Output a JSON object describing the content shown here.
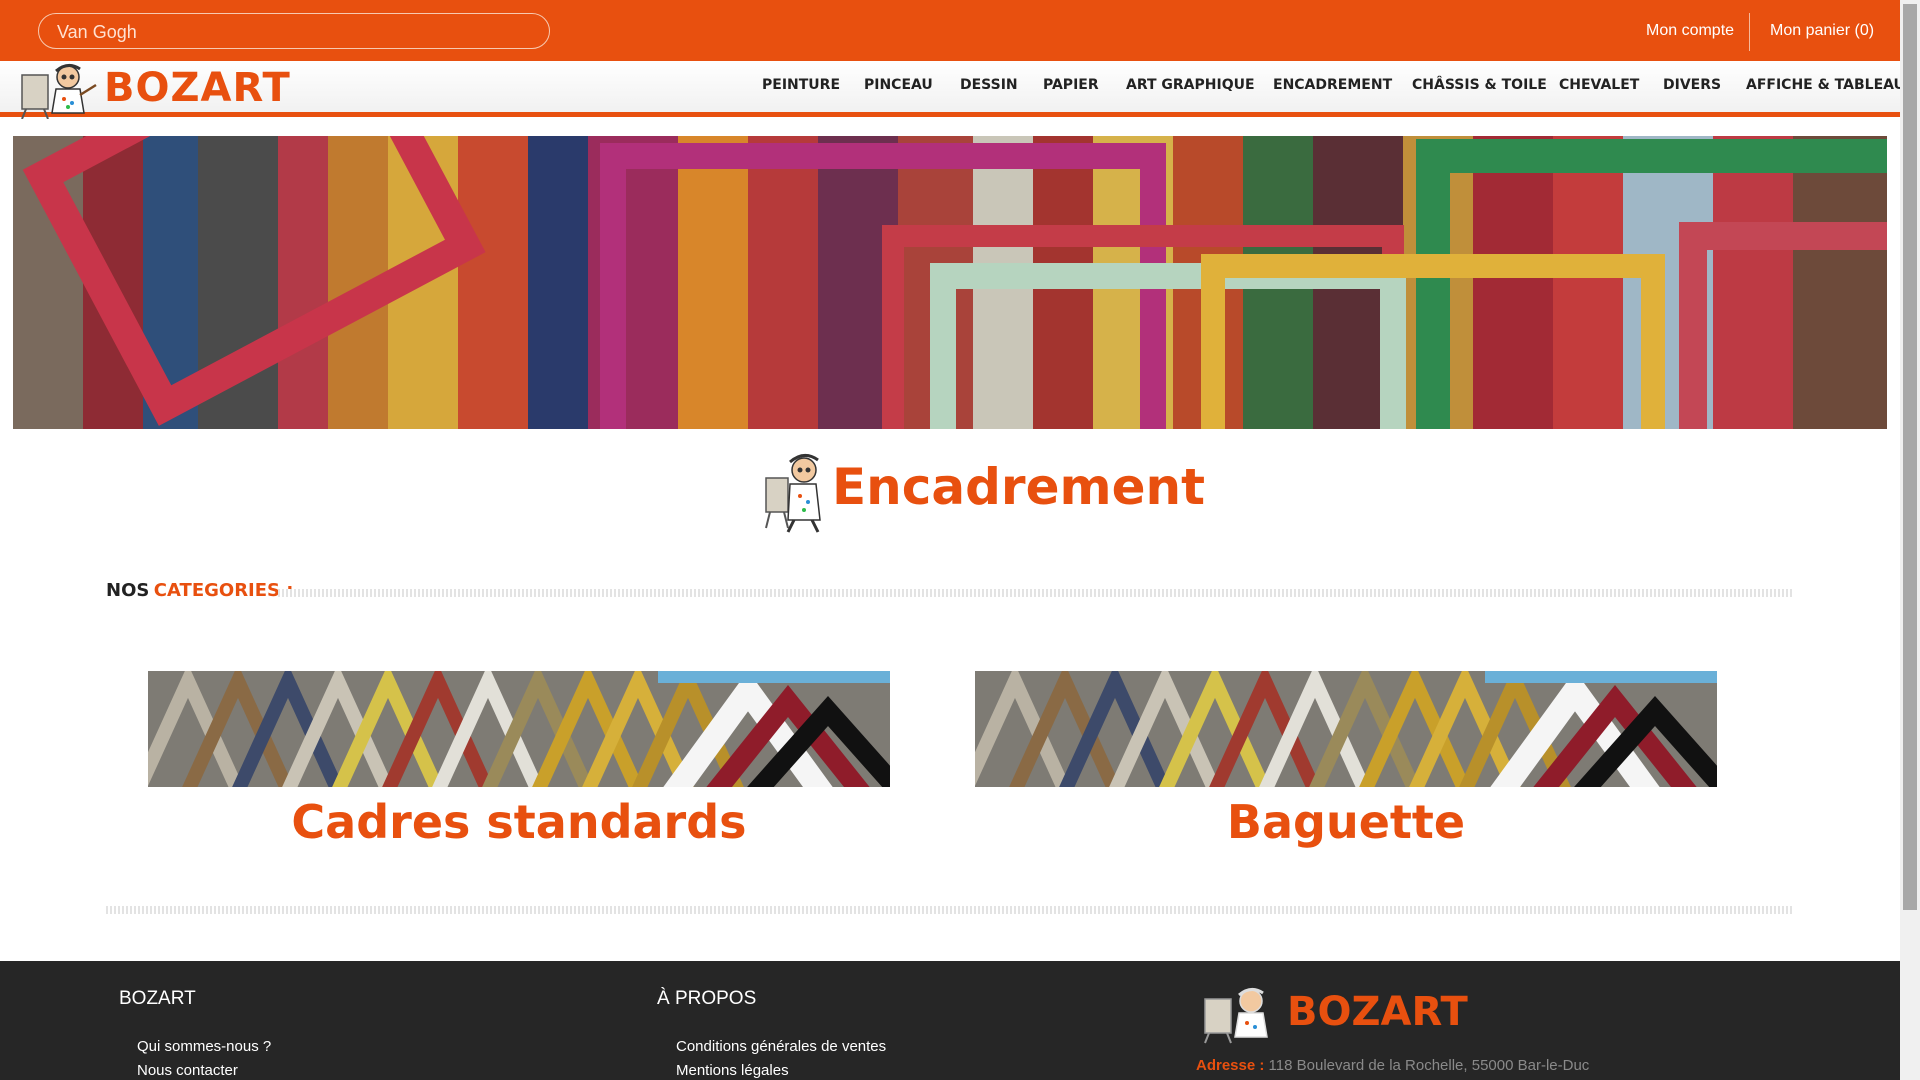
{
  "header": {
    "search": {
      "value": "Van Gogh",
      "placeholder": ""
    },
    "account_label": "Mon compte",
    "cart_label": "Mon panier (0)"
  },
  "brand": {
    "name": "BOZART",
    "logo_icon": "painter-caricature-icon"
  },
  "nav": {
    "items": [
      {
        "label": "PEINTURE"
      },
      {
        "label": "PINCEAU"
      },
      {
        "label": "DESSIN"
      },
      {
        "label": "PAPIER"
      },
      {
        "label": "ART GRAPHIQUE"
      },
      {
        "label": "ENCADREMENT"
      },
      {
        "label": "CHÂSSIS & TOILE"
      },
      {
        "label": "CHEVALET"
      },
      {
        "label": "DIVERS"
      },
      {
        "label": "AFFICHE & TABLEAU"
      }
    ]
  },
  "hero": {
    "image": "colorful-picture-frames-banner"
  },
  "main": {
    "title": "Encadrement",
    "section": {
      "prefix": "NOS",
      "highlight": "CATEGORIES :"
    },
    "categories": [
      {
        "label": "Cadres standards",
        "image": "frame-moulding-samples"
      },
      {
        "label": "Baguette",
        "image": "frame-moulding-samples"
      }
    ]
  },
  "footer": {
    "col1": {
      "title": "BOZART",
      "links": [
        "Qui sommes-nous ?",
        "Nous contacter"
      ]
    },
    "col2": {
      "title": "À PROPOS",
      "links": [
        "Conditions générales de ventes",
        "Mentions légales"
      ]
    },
    "contact": {
      "brand": "BOZART",
      "address_label": "Adresse :",
      "address": "118 Boulevard de la Rochelle, 55000 Bar-le-Duc"
    }
  },
  "colors": {
    "accent": "#e8500f",
    "footer_bg": "#262626",
    "text_dark": "#222222"
  }
}
